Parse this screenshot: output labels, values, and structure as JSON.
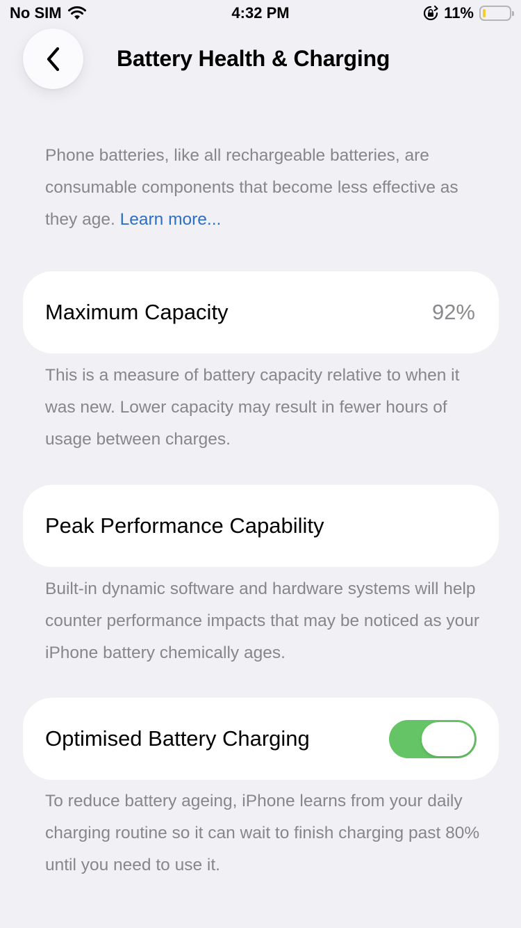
{
  "status_bar": {
    "carrier": "No SIM",
    "time": "4:32 PM",
    "battery_percent": "11%",
    "battery_level": 0.11,
    "icons": [
      "wifi-icon",
      "orientation-lock-icon",
      "battery-icon"
    ]
  },
  "nav": {
    "back_icon": "chevron-left-icon",
    "title": "Battery Health & Charging"
  },
  "intro": {
    "text": "Phone batteries, like all rechargeable batteries, are consumable components that become less effective as they age.",
    "link": "Learn more..."
  },
  "max_capacity": {
    "label": "Maximum Capacity",
    "value": "92%",
    "footnote": "This is a measure of battery capacity relative to when it was new. Lower capacity may result in fewer hours of usage between charges."
  },
  "peak_performance": {
    "label": "Peak Performance Capability",
    "footnote": "Built-in dynamic software and hardware systems will help counter performance impacts that may be noticed as your iPhone battery chemically ages."
  },
  "optimised_charging": {
    "label": "Optimised Battery Charging",
    "enabled": true,
    "footnote": "To reduce battery ageing, iPhone learns from your daily charging routine so it can wait to finish charging past 80% until you need to use it."
  },
  "colors": {
    "background": "#f0f0f5",
    "toggle_on": "#65c466",
    "link": "#2c6fc4",
    "battery_low": "#f4cd33"
  }
}
